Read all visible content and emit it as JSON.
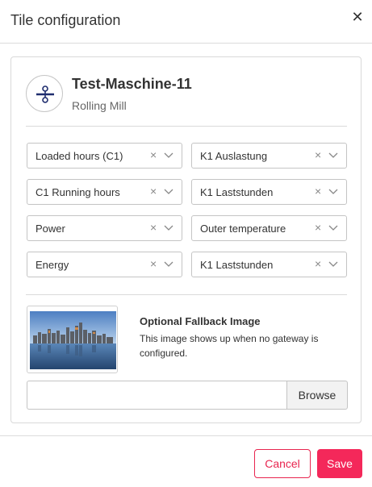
{
  "dialog": {
    "title": "Tile configuration",
    "close_icon": "close-icon"
  },
  "machine": {
    "icon": "machine-icon",
    "name": "Test-Maschine-11",
    "type": "Rolling Mill"
  },
  "kpis": [
    {
      "left": "Loaded hours (C1)",
      "right": "K1 Auslastung"
    },
    {
      "left": "C1 Running hours",
      "right": "K1 Laststunden"
    },
    {
      "left": "Power",
      "right": "Outer temperature"
    },
    {
      "left": "Energy",
      "right": "K1 Laststunden"
    }
  ],
  "select_clear_glyph": "×",
  "fallback": {
    "image": "city-skyline-image",
    "title": "Optional Fallback Image",
    "description": "This image shows up when no gateway is configured.",
    "file_value": "",
    "browse_label": "Browse"
  },
  "footer": {
    "cancel_label": "Cancel",
    "save_label": "Save"
  },
  "colors": {
    "accent": "#f4285a",
    "icon_blue": "#1f2d6e"
  }
}
